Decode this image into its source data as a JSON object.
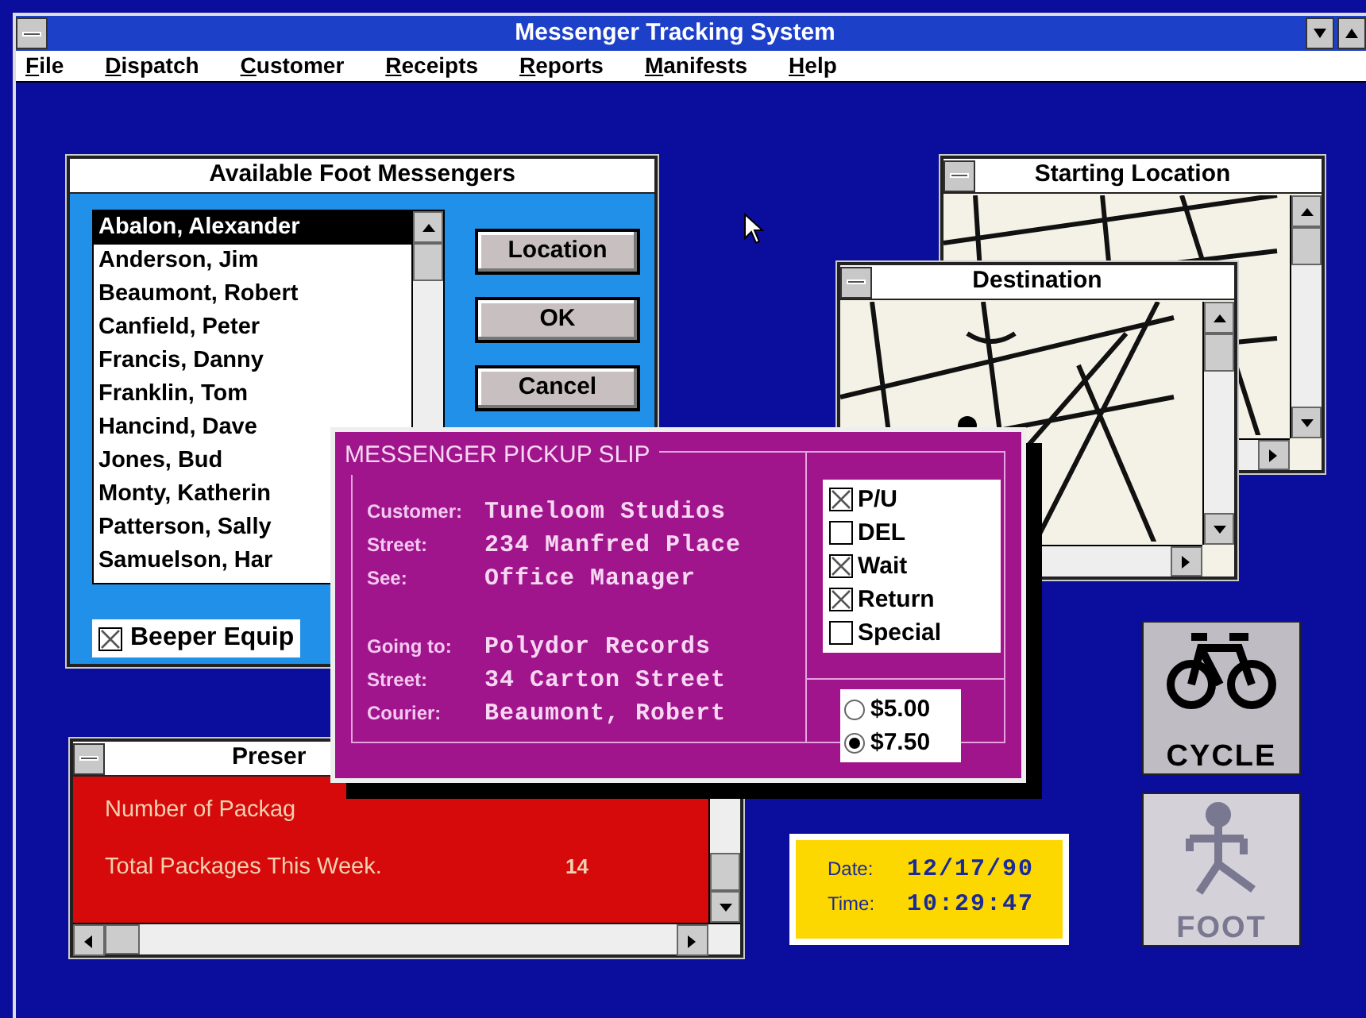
{
  "window": {
    "title": "Messenger Tracking System"
  },
  "menu": [
    {
      "label": "File"
    },
    {
      "label": "Dispatch"
    },
    {
      "label": "Customer"
    },
    {
      "label": "Receipts"
    },
    {
      "label": "Reports"
    },
    {
      "label": "Manifests"
    },
    {
      "label": "Help"
    }
  ],
  "messengers": {
    "title": "Available Foot Messengers",
    "items": [
      {
        "label": "Abalon, Alexander",
        "selected": true
      },
      {
        "label": "Anderson, Jim",
        "selected": false
      },
      {
        "label": "Beaumont, Robert",
        "selected": false
      },
      {
        "label": "Canfield, Peter",
        "selected": false
      },
      {
        "label": "Francis, Danny",
        "selected": false
      },
      {
        "label": "Franklin, Tom",
        "selected": false
      },
      {
        "label": "Hancind, Dave",
        "selected": false
      },
      {
        "label": "Jones, Bud",
        "selected": false
      },
      {
        "label": "Monty, Katherin",
        "selected": false
      },
      {
        "label": "Patterson, Sally",
        "selected": false
      },
      {
        "label": "Samuelson, Har",
        "selected": false
      }
    ],
    "buttons": [
      "Location",
      "OK",
      "Cancel"
    ],
    "beeper": {
      "label": "Beeper Equip",
      "checked": true
    }
  },
  "starting_location": {
    "title": "Starting Location"
  },
  "destination": {
    "title": "Destination"
  },
  "pickup_slip": {
    "title": "MESSENGER PICKUP SLIP",
    "sections": [
      [
        {
          "label": "Customer:",
          "value": "Tuneloom Studios"
        },
        {
          "label": "Street:",
          "value": "234 Manfred Place"
        },
        {
          "label": "See:",
          "value": "Office Manager"
        }
      ],
      [
        {
          "label": "Going to:",
          "value": "Polydor Records"
        },
        {
          "label": "Street:",
          "value": "34 Carton Street"
        },
        {
          "label": "Courier:",
          "value": "Beaumont, Robert"
        }
      ]
    ],
    "options": [
      {
        "label": "P/U",
        "checked": true
      },
      {
        "label": "DEL",
        "checked": false
      },
      {
        "label": "Wait",
        "checked": true
      },
      {
        "label": "Return",
        "checked": true
      },
      {
        "label": "Special",
        "checked": false
      }
    ],
    "fares": [
      {
        "label": "$5.00",
        "selected": false
      },
      {
        "label": "$7.50",
        "selected": true
      }
    ]
  },
  "packages": {
    "title": "Preser",
    "rows": [
      {
        "label": "Number of Packag"
      },
      {
        "label": "Total Packages This Week.",
        "value": "14"
      }
    ]
  },
  "clock": {
    "rows": [
      {
        "label": "Date:",
        "value": "12/17/90"
      },
      {
        "label": "Time:",
        "value": "10:29:47"
      }
    ]
  },
  "modes": [
    {
      "kind": "bicycle",
      "label": "CYCLE",
      "dimmed": false
    },
    {
      "kind": "walker",
      "label": "FOOT",
      "dimmed": true
    }
  ]
}
